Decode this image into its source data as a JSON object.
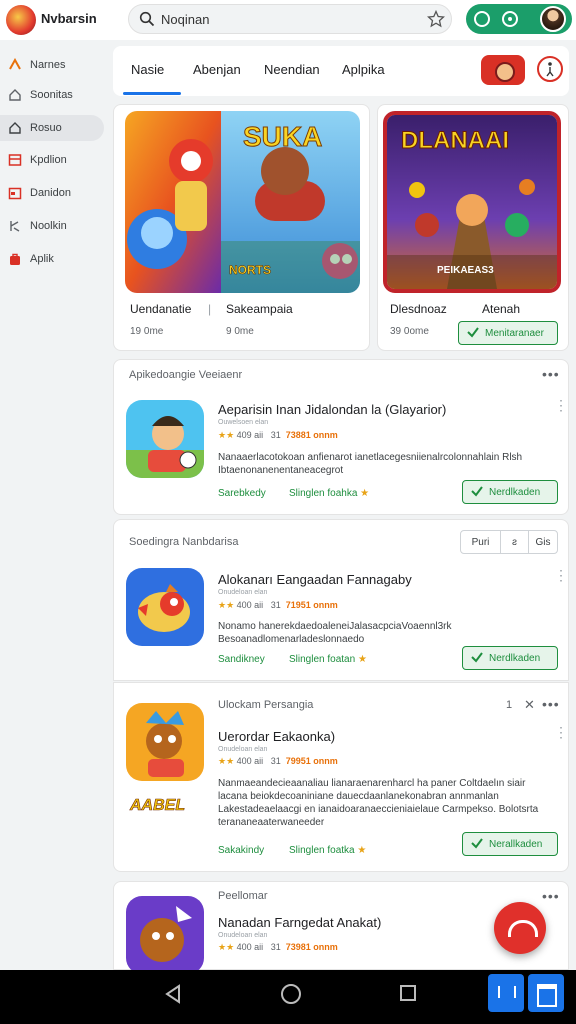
{
  "header": {
    "app_title": "Nvbarsin",
    "search_value": "Noqinan"
  },
  "sidebar": {
    "items": [
      {
        "label": "Narnes",
        "icon": "star-icon"
      },
      {
        "label": "Soonitas",
        "icon": "home-icon"
      },
      {
        "label": "Rosuo",
        "icon": "home-outline-icon"
      },
      {
        "label": "Kpdlion",
        "icon": "library-icon"
      },
      {
        "label": "Danidon",
        "icon": "calendar-icon"
      },
      {
        "label": "Noolkin",
        "icon": "broken-icon"
      },
      {
        "label": "Aplik",
        "icon": "bag-icon"
      }
    ]
  },
  "tabs": [
    "Nasie",
    "Abenjan",
    "Neendian",
    "Aplpika"
  ],
  "featured": [
    {
      "title_left": "Uendanatie",
      "title_mid": "Sakeampaia",
      "meta_left": "19 0me",
      "meta_right": "9 0me",
      "banner_text": "SUKA",
      "banner_sub": "NORTS"
    },
    {
      "title": "Dlesdnoaz",
      "title_tail": "Atenah",
      "meta": "39 0ome",
      "install_label": "Menitaranaer",
      "banner_text": "DLANAAI",
      "banner_sub": "PEIKAEAS3"
    }
  ],
  "section1": {
    "title": "Apikedoangie Veeiaenr",
    "app": {
      "name": "Aeparisin Inan Jidalondan la (Glayarior)",
      "dev": "Ouwelsoen elan",
      "rating": "4.5",
      "stars": "★★",
      "meta_a": "409 aii",
      "meta_b": "31",
      "count": "73881 onnm",
      "desc": "Nanaaerlacotokoan anfienarot ianetlacegesniienalrcolonnahlain Rlsh Ibtaenonanenentaneacegrot",
      "link_a": "Sarebkedy",
      "link_b": "Slinglen foahka",
      "install_label": "Nerdlkaden"
    }
  },
  "section2": {
    "title": "Soedingra Nanbdarisa",
    "seg": [
      "Puri",
      "ƨ",
      "Gis"
    ],
    "app": {
      "name": "Alokanarı Eangaadan Fannagaby",
      "dev": "Onudeloan elan",
      "stars": "★★",
      "meta_a": "400 aii",
      "meta_b": "31",
      "count": "71951 onnm",
      "desc": "Nonamo hanerekdaedoaleneiJalasacpciaVoaennl3rk Besoanadlomenarladeslonnaedo",
      "link_a": "Sandikney",
      "link_b": "Slinglen foatan",
      "install_label": "Nerdlkaden"
    }
  },
  "section3": {
    "title": "Ulockam Persangia",
    "page_num": "1",
    "app": {
      "name": "Uerordar Eakaonka)",
      "dev": "Onudeloan elan",
      "stars": "★★",
      "meta_a": "400 aii",
      "meta_b": "31",
      "count": "79951 onnm",
      "desc": "Nanmaeandecieaanaliau lianaraenarenharcl ha paner Coltdaelın siair lacana beiokdecoaniniane dauecdaanlanekonabran annmanlan Lakestadeaelaacgi en ianaidoaranaeccieniaielaue Carmpekso. Bolotsrta terananeaaterwaneeder",
      "link_a": "Sakakindy",
      "link_b": "Slinglen foatka",
      "install_label": "Nerallkaden",
      "brand_text": "AABEL"
    }
  },
  "section4": {
    "title": "Peellomar",
    "app": {
      "name": "Nanadan Farngedat Anakat)",
      "dev": "Onudeloan elan",
      "stars": "★★",
      "meta_a": "400 aii",
      "meta_b": "31",
      "count": "73981 onnm"
    }
  }
}
